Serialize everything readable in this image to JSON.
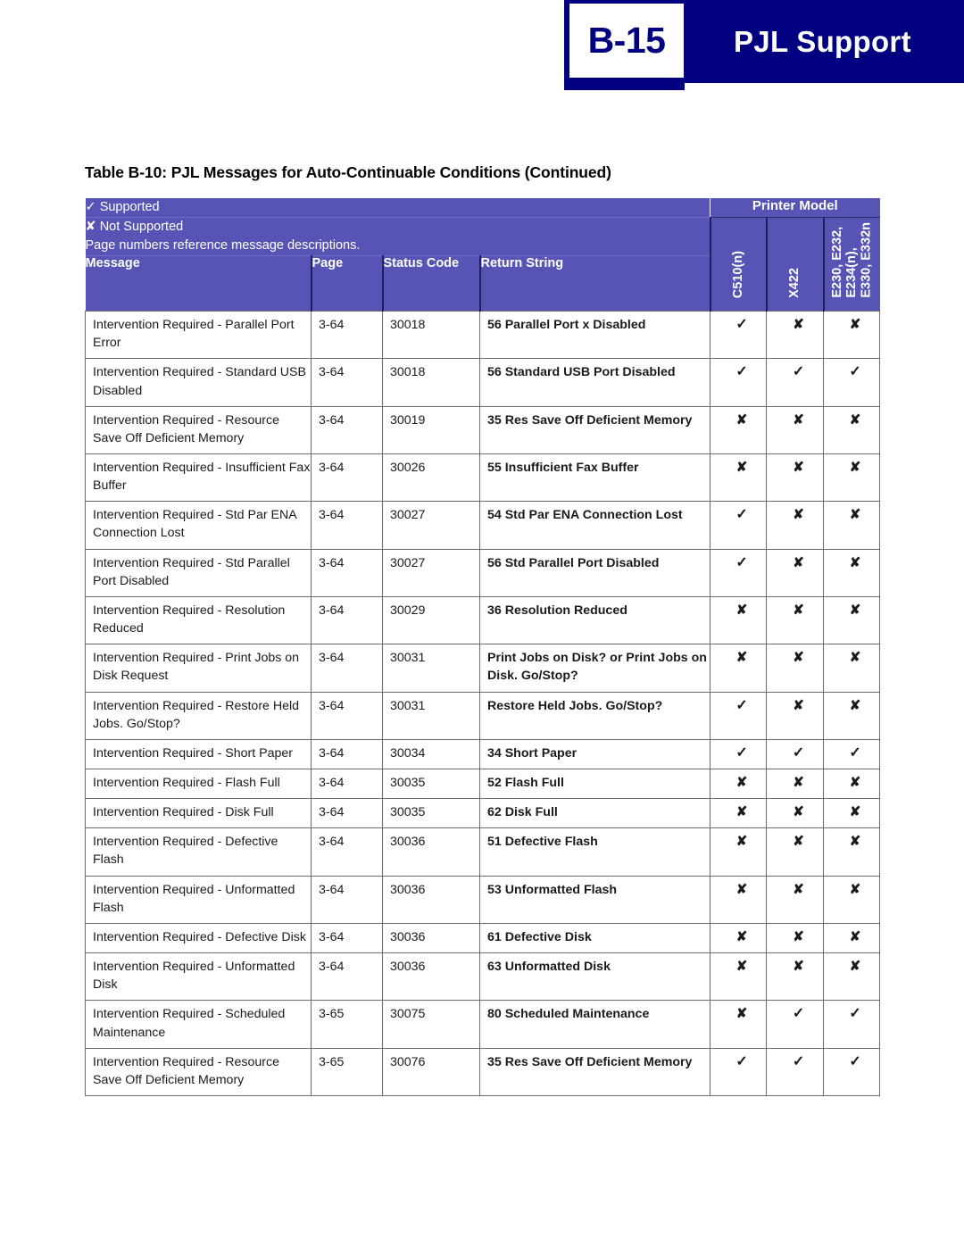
{
  "banner": {
    "page_number": "B-15",
    "section_title": "PJL Support",
    "navy": "#000080"
  },
  "table": {
    "caption": "Table B-10:  PJL Messages for Auto-Continuable Conditions (Continued)",
    "legend": {
      "supported_symbol": "✓",
      "supported_label": "Supported",
      "not_supported_symbol": "✘",
      "not_supported_label": "Not Supported",
      "note": "Page numbers reference message descriptions."
    },
    "group_header": "Printer Model",
    "columns": [
      "Message",
      "Page",
      "Status Code",
      "Return String"
    ],
    "model_columns": [
      "C510(n)",
      "X422",
      "E230, E232,\nE234(n),\nE330, E332n"
    ],
    "header_bg": "#5754b5",
    "return_string_color": "#141496",
    "rows": [
      {
        "message": "Intervention Required - Parallel Port Error",
        "page": "3-64",
        "status_code": "30018",
        "return_string": "56 Parallel Port x Disabled",
        "support": [
          "✓",
          "✘",
          "✘"
        ]
      },
      {
        "message": "Intervention Required - Standard USB Disabled",
        "page": "3-64",
        "status_code": "30018",
        "return_string": "56 Standard USB Port Disabled",
        "support": [
          "✓",
          "✓",
          "✓"
        ]
      },
      {
        "message": "Intervention Required - Resource Save Off Deficient Memory",
        "page": "3-64",
        "status_code": "30019",
        "return_string": "35 Res Save Off Deficient Memory",
        "support": [
          "✘",
          "✘",
          "✘"
        ]
      },
      {
        "message": "Intervention Required - Insufficient Fax Buffer",
        "page": "3-64",
        "status_code": "30026",
        "return_string": "55 Insufficient Fax Buffer",
        "support": [
          "✘",
          "✘",
          "✘"
        ]
      },
      {
        "message": "Intervention Required - Std Par ENA Connection Lost",
        "page": "3-64",
        "status_code": "30027",
        "return_string": "54 Std Par ENA Connection Lost",
        "support": [
          "✓",
          "✘",
          "✘"
        ]
      },
      {
        "message": "Intervention Required - Std Parallel Port Disabled",
        "page": "3-64",
        "status_code": "30027",
        "return_string": "56 Std Parallel Port Disabled",
        "support": [
          "✓",
          "✘",
          "✘"
        ]
      },
      {
        "message": "Intervention Required - Resolution Reduced",
        "page": "3-64",
        "status_code": "30029",
        "return_string": "36 Resolution Reduced",
        "support": [
          "✘",
          "✘",
          "✘"
        ]
      },
      {
        "message": "Intervention Required - Print Jobs on Disk Request",
        "page": "3-64",
        "status_code": "30031",
        "return_string": "Print Jobs on Disk? or Print Jobs on Disk. Go/Stop?",
        "support": [
          "✘",
          "✘",
          "✘"
        ]
      },
      {
        "message": "Intervention Required - Restore Held Jobs. Go/Stop?",
        "page": "3-64",
        "status_code": "30031",
        "return_string": "Restore Held Jobs. Go/Stop?",
        "support": [
          "✓",
          "✘",
          "✘"
        ]
      },
      {
        "message": "Intervention Required - Short Paper",
        "page": "3-64",
        "status_code": "30034",
        "return_string": "34 Short Paper",
        "support": [
          "✓",
          "✓",
          "✓"
        ]
      },
      {
        "message": "Intervention Required - Flash Full",
        "page": "3-64",
        "status_code": "30035",
        "return_string": "52 Flash Full",
        "support": [
          "✘",
          "✘",
          "✘"
        ]
      },
      {
        "message": "Intervention Required - Disk Full",
        "page": "3-64",
        "status_code": "30035",
        "return_string": "62 Disk Full",
        "support": [
          "✘",
          "✘",
          "✘"
        ]
      },
      {
        "message": "Intervention Required - Defective Flash",
        "page": "3-64",
        "status_code": "30036",
        "return_string": "51 Defective Flash",
        "support": [
          "✘",
          "✘",
          "✘"
        ]
      },
      {
        "message": "Intervention Required - Unformatted Flash",
        "page": "3-64",
        "status_code": "30036",
        "return_string": "53 Unformatted Flash",
        "support": [
          "✘",
          "✘",
          "✘"
        ]
      },
      {
        "message": "Intervention Required - Defective Disk",
        "page": "3-64",
        "status_code": "30036",
        "return_string": "61 Defective Disk",
        "support": [
          "✘",
          "✘",
          "✘"
        ]
      },
      {
        "message": "Intervention Required - Unformatted Disk",
        "page": "3-64",
        "status_code": "30036",
        "return_string": "63 Unformatted Disk",
        "support": [
          "✘",
          "✘",
          "✘"
        ]
      },
      {
        "message": "Intervention Required - Scheduled Maintenance",
        "page": "3-65",
        "status_code": "30075",
        "return_string": "80 Scheduled Maintenance",
        "support": [
          "✘",
          "✓",
          "✓"
        ]
      },
      {
        "message": "Intervention Required - Resource Save Off Deficient Memory",
        "page": "3-65",
        "status_code": "30076",
        "return_string": "35 Res Save Off Deficient Memory",
        "support": [
          "✓",
          "✓",
          "✓"
        ]
      }
    ]
  }
}
